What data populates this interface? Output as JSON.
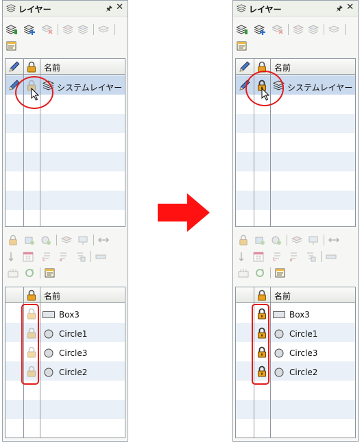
{
  "panel_title": "レイヤー",
  "pin_glyph": "🖈",
  "close_glyph": "✕",
  "column_name_header": "名前",
  "layer_rows": [
    {
      "name": "システムレイヤー"
    }
  ],
  "object_rows": [
    {
      "name": "Box3",
      "shape": "rectangle"
    },
    {
      "name": "Circle1",
      "shape": "circle"
    },
    {
      "name": "Circle3",
      "shape": "circle"
    },
    {
      "name": "Circle2",
      "shape": "circle"
    }
  ],
  "states": {
    "left": {
      "lock": "unlocked-disabled"
    },
    "right": {
      "lock": "locked"
    }
  },
  "colors": {
    "highlight_red": "#e21b1b",
    "arrow_red": "#ff1111",
    "selected_row": "#c9d9ee",
    "alt_row": "#eaf0f8"
  }
}
